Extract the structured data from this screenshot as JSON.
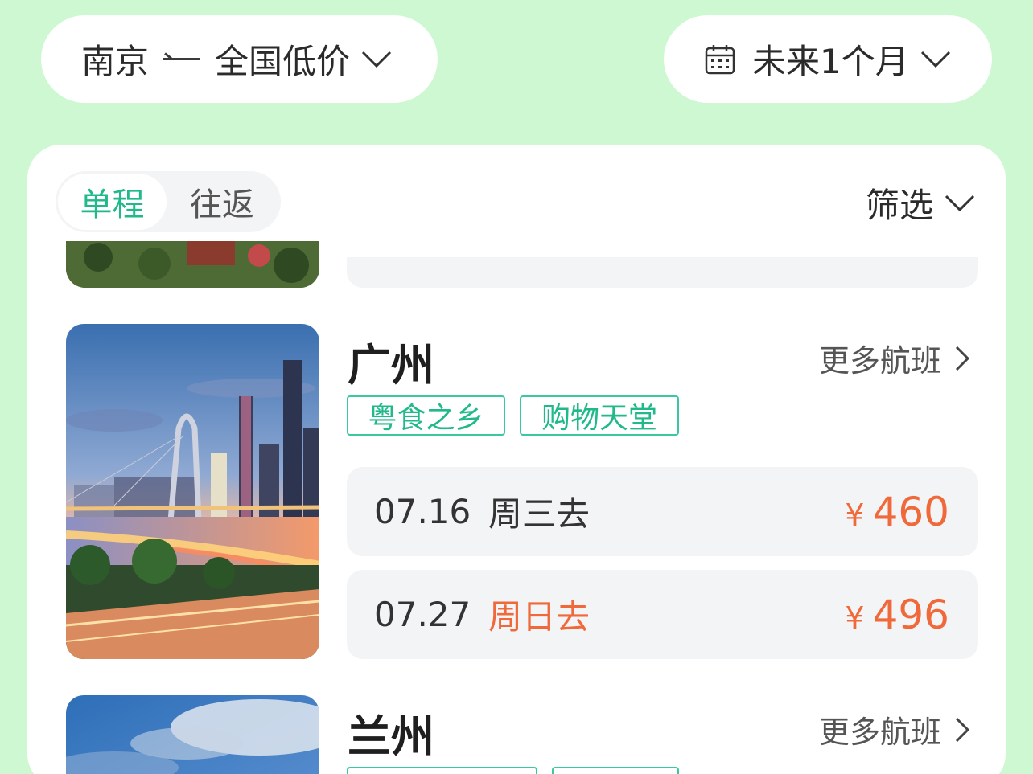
{
  "top": {
    "origin": "南京",
    "destination": "全国低价",
    "date_range": "未来1个月"
  },
  "tabs": {
    "oneway": "单程",
    "roundtrip": "往返"
  },
  "filter_label": "筛选",
  "cities": [
    {
      "name": "广州",
      "more_label": "更多航班",
      "tags": [
        "粤食之乡",
        "购物天堂"
      ],
      "flights": [
        {
          "date": "07.16",
          "day": "周三去",
          "weekend": false,
          "currency": "¥",
          "price": "460"
        },
        {
          "date": "07.27",
          "day": "周日去",
          "weekend": true,
          "currency": "¥",
          "price": "496"
        }
      ]
    },
    {
      "name": "兰州",
      "more_label": "更多航班"
    }
  ],
  "colors": {
    "accent": "#1fb98a",
    "price": "#f0693a",
    "background": "#cdf8d2"
  }
}
